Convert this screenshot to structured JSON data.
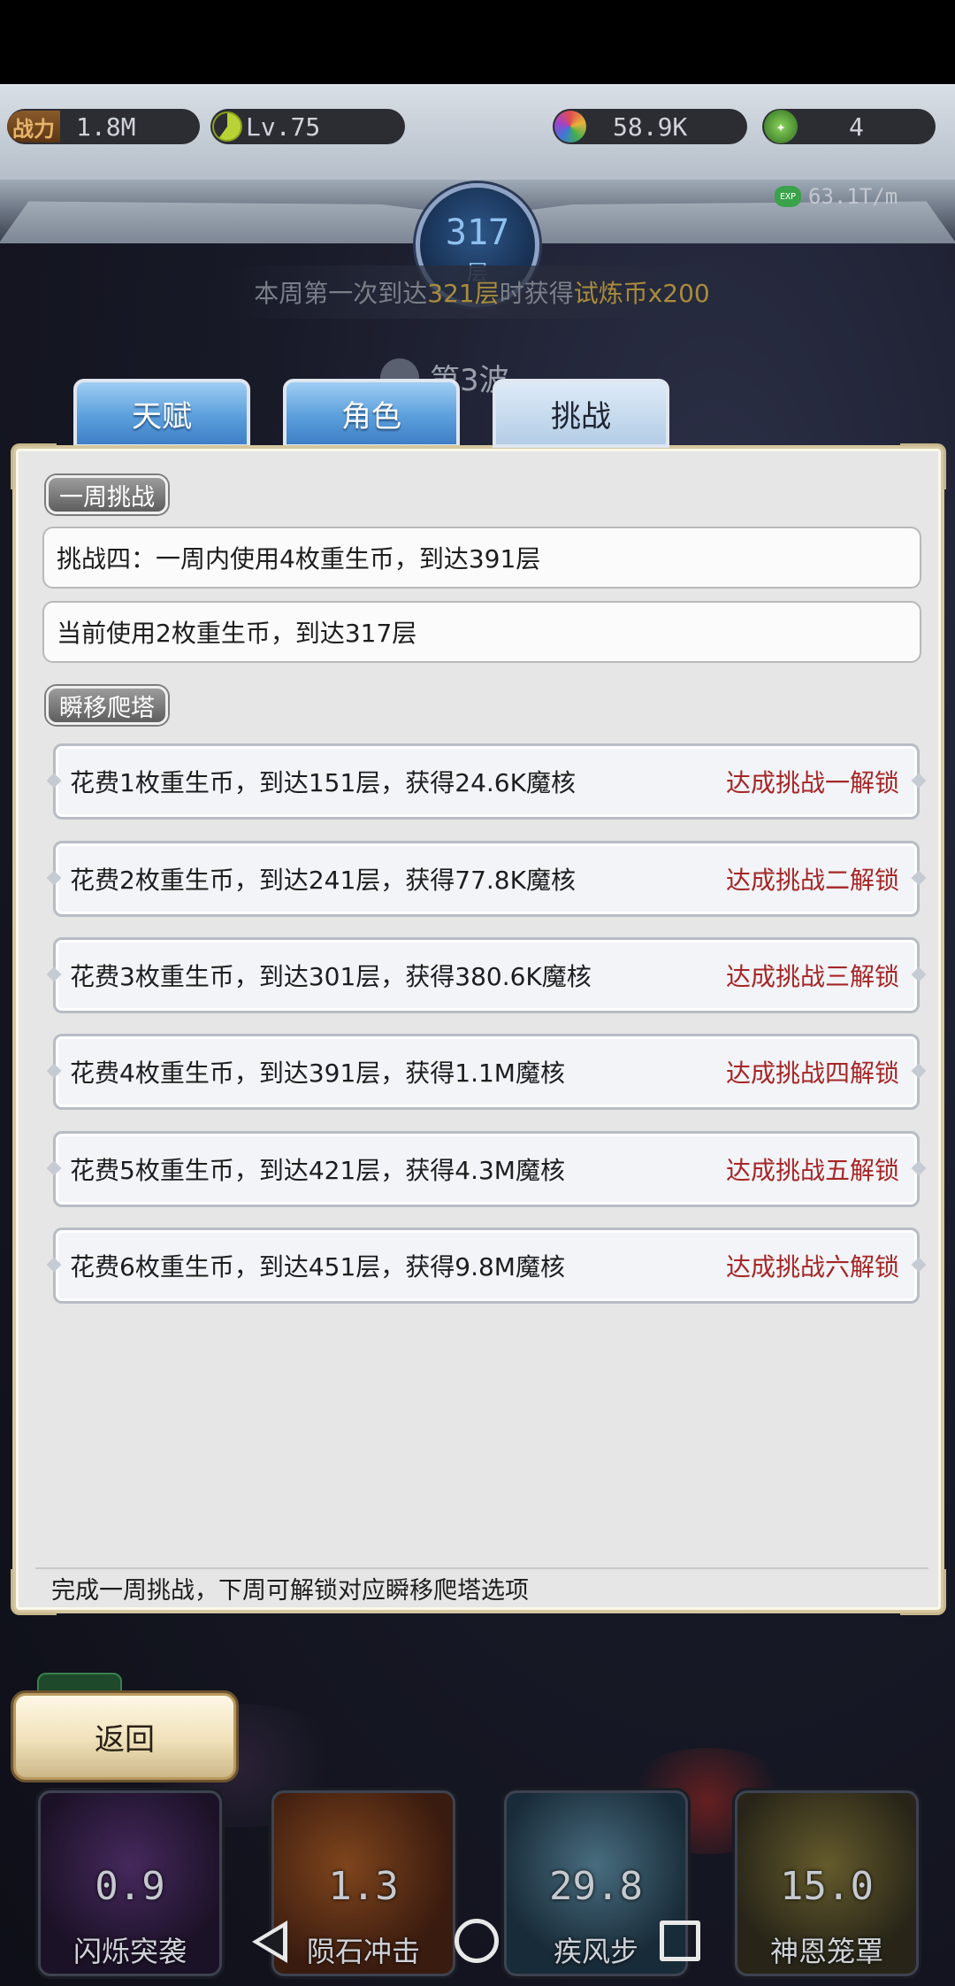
{
  "topbar": {
    "power_label": "战力",
    "power_value": "1.8M",
    "level_value": "Lv.75",
    "gem_value": "58.9K",
    "leaf_value": "4",
    "floor_number": "317",
    "floor_unit": "层",
    "exp_icon_text": "EXP",
    "exp_rate": "63.1T/m"
  },
  "banner": {
    "prefix": "本周第一次到达",
    "floor": "321层",
    "middle": "时获得",
    "reward": "试炼币x200"
  },
  "wave": "第3波",
  "tabs": [
    "天赋",
    "角色",
    "挑战"
  ],
  "weekly": {
    "label": "一周挑战",
    "challenge": "挑战四：一周内使用4枚重生币，到达391层",
    "progress": "当前使用2枚重生币，到达317层"
  },
  "teleport": {
    "label": "瞬移爬塔",
    "rows": [
      {
        "text": "花费1枚重生币，到达151层，获得24.6K魔核",
        "lock": "达成挑战一解锁"
      },
      {
        "text": "花费2枚重生币，到达241层，获得77.8K魔核",
        "lock": "达成挑战二解锁"
      },
      {
        "text": "花费3枚重生币，到达301层，获得380.6K魔核",
        "lock": "达成挑战三解锁"
      },
      {
        "text": "花费4枚重生币，到达391层，获得1.1M魔核",
        "lock": "达成挑战四解锁"
      },
      {
        "text": "花费5枚重生币，到达421层，获得4.3M魔核",
        "lock": "达成挑战五解锁"
      },
      {
        "text": "花费6枚重生币，到达451层，获得9.8M魔核",
        "lock": "达成挑战六解锁"
      }
    ]
  },
  "footer_note": "完成一周挑战，下周可解锁对应瞬移爬塔选项",
  "return_label": "返回",
  "skills": [
    {
      "cooldown": "0.9",
      "name": "闪烁突袭"
    },
    {
      "cooldown": "1.3",
      "name": "陨石冲击"
    },
    {
      "cooldown": "29.8",
      "name": "疾风步"
    },
    {
      "cooldown": "15.0",
      "name": "神恩笼罩"
    }
  ],
  "colors": {
    "lock_text": "#a62626",
    "banner_highlight": "#a98c3b",
    "tab_active": "#b4cde6",
    "tab_inactive": "#5b9fdc"
  }
}
